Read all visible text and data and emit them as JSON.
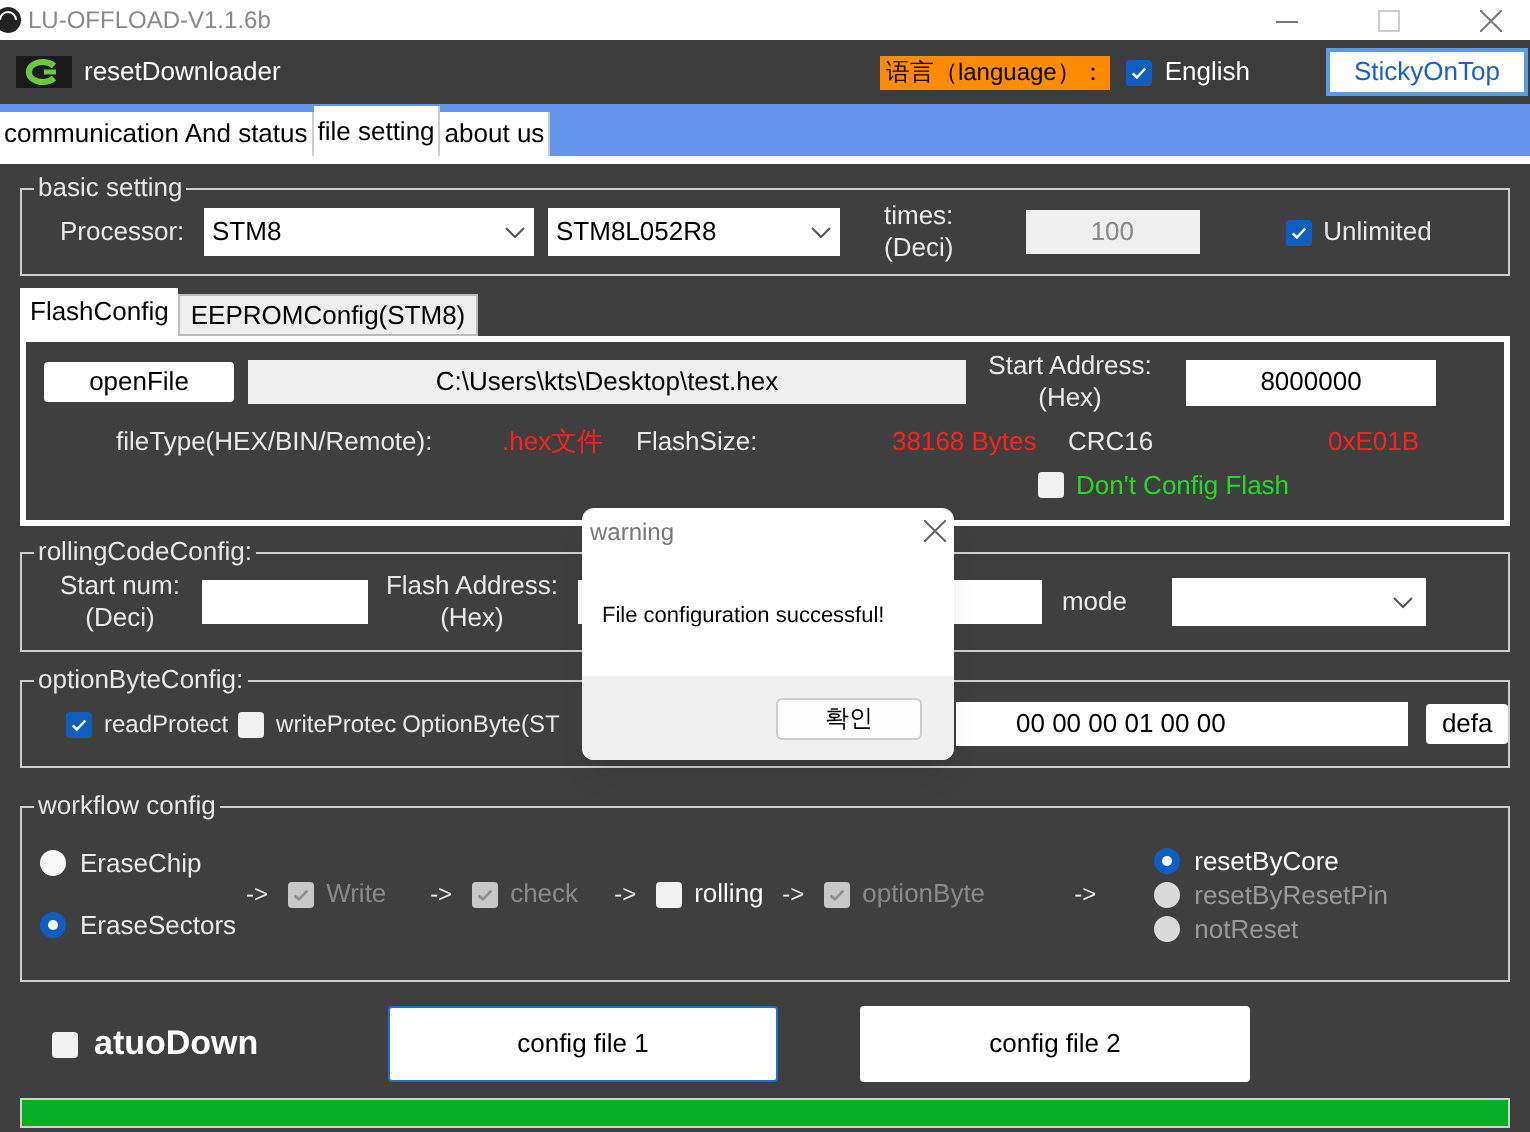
{
  "window": {
    "title": "LU-OFFLOAD-V1.1.6b"
  },
  "header": {
    "app_name": "resetDownloader",
    "language_label": "语言（language）：",
    "english": {
      "label": "English",
      "checked": true
    },
    "sticky_button": "StickyOnTop"
  },
  "tabs": [
    {
      "label": "communication And status",
      "selected": false
    },
    {
      "label": "file setting",
      "selected": true
    },
    {
      "label": "about us",
      "selected": false
    }
  ],
  "basic_setting": {
    "title": "basic setting",
    "processor_label": "Processor:",
    "processor": "STM8",
    "model": "STM8L052R8",
    "times_label": "times:",
    "times_unit": "(Deci)",
    "times_value": "100",
    "unlimited": {
      "label": "Unlimited",
      "checked": true
    }
  },
  "sub_tabs": [
    {
      "label": "FlashConfig",
      "selected": true
    },
    {
      "label": "EEPROMConfig(STM8)",
      "selected": false
    }
  ],
  "flash_config": {
    "open_button": "openFile",
    "file_path": "C:\\Users\\kts\\Desktop\\test.hex",
    "start_address_label": "Start Address:",
    "start_address_unit": "(Hex)",
    "start_address": "8000000",
    "file_type_label": "fileType(HEX/BIN/Remote):",
    "file_type": ".hex文件",
    "flash_size_label": "FlashSize:",
    "flash_size": "38168 Bytes",
    "crc_label": "CRC16",
    "crc": "0xE01B",
    "dont_config": {
      "label": "Don't Config Flash",
      "checked": false
    }
  },
  "rolling_code": {
    "title": "rollingCodeConfig:",
    "start_label": "Start num:",
    "start_unit": "(Deci)",
    "address_label": "Flash Address:",
    "address_unit": "(Hex)",
    "mode_label": "mode"
  },
  "option_byte": {
    "title": "optionByteConfig:",
    "read_protect": {
      "label": "readProtect",
      "checked": true
    },
    "write_protect": {
      "label": "writeProtec",
      "checked": false
    },
    "option_label": "OptionByte(ST",
    "value": "00 00 00 01 00 00",
    "default_button": "defa"
  },
  "workflow": {
    "title": "workflow config",
    "erase": [
      {
        "label": "EraseChip",
        "selected": false
      },
      {
        "label": "EraseSectors",
        "selected": true
      }
    ],
    "steps": [
      {
        "label": "Write",
        "checked": true,
        "disabled": true
      },
      {
        "label": "check",
        "checked": true,
        "disabled": true
      },
      {
        "label": "rolling",
        "checked": false,
        "disabled": false
      },
      {
        "label": "optionByte",
        "checked": true,
        "disabled": true
      }
    ],
    "arrow": "->",
    "reset": [
      {
        "label": "resetByCore",
        "selected": true,
        "disabled": false
      },
      {
        "label": "resetByResetPin",
        "selected": false,
        "disabled": true
      },
      {
        "label": "notReset",
        "selected": false,
        "disabled": true
      }
    ]
  },
  "bottom": {
    "auto_down": {
      "label": "atuoDown",
      "checked": false
    },
    "buttons": [
      {
        "label": "config file 1",
        "selected": true
      },
      {
        "label": "config file 2",
        "selected": false
      }
    ],
    "progress": {
      "level": 1
    }
  },
  "dialog": {
    "title": "warning",
    "message": "File configuration successful!",
    "ok_button": "확인"
  }
}
